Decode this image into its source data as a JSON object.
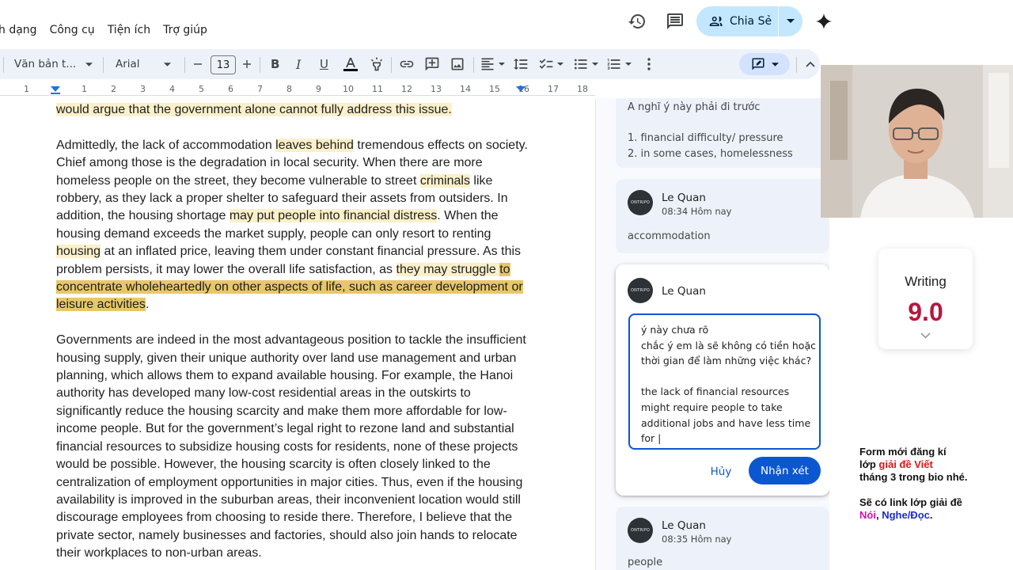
{
  "menu": [
    "h dạng",
    "Công cụ",
    "Tiện ích",
    "Trợ giúp"
  ],
  "header": {
    "share_label": "Chia Sẻ"
  },
  "toolbar": {
    "style_value": "Văn bản t...",
    "font_value": "Arial",
    "font_size": "13"
  },
  "ruler": {
    "numbers": [
      "1",
      "1",
      "2",
      "3",
      "4",
      "5",
      "6",
      "7",
      "8",
      "9",
      "10",
      "11",
      "12",
      "13",
      "14",
      "15",
      "16",
      "17",
      "18"
    ]
  },
  "document": {
    "p0_l1": "would argue that the government alone cannot fully address this issue.",
    "p1": {
      "a": "Admittedly, the lack of accommodation ",
      "b": "leaves behind",
      "c": " tremendous effects on society. Chief among those is the degradation in local security. When there are more homeless people on the street, they become vulnerable to street ",
      "d": "criminals",
      "e": " like robbery, as they lack a proper shelter to safeguard their assets from outsiders. In addition, the housing shortage ",
      "f": "may put people into financial distress",
      "g": ". When the housing demand exceeds the market supply, people can only resort to renting ",
      "h": "housing",
      "i": " at an inflated price, leaving them under constant financial pressure. As this problem persists, it may lower the overall life satisfaction, as ",
      "j": "they may struggle ",
      "k": "to concentrate wholeheartedly on other aspects of life, such as career development or leisure activities",
      "l": "."
    },
    "p2": "Governments are indeed in the most advantageous position to tackle the insufficient housing supply, given their unique authority over land use management and urban planning, which allows them to expand available housing. For example, the Hanoi authority has developed many low-cost residential areas in the outskirts to significantly reduce the housing scarcity and make them more affordable for low-income people. But for the government’s legal right to rezone land and substantial financial resources to subsidize housing costs for residents, none of these projects would be possible. However, the housing scarcity is often closely linked to the centralization of employment opportunities in major cities. Thus, even if the housing availability is improved in the suburban areas, their inconvenient location would still discourage employees from choosing to reside there. Therefore, I believe that the private sector, namely businesses and factories, should also join hands to relocate their workplaces to non-urban areas."
  },
  "comments": {
    "c0": {
      "line1": "A nghĩ ý này phải đi trước",
      "line2": "1. financial difficulty/ pressure",
      "line3": "2. in some cases, homelessness"
    },
    "c1": {
      "avatar": "ONTRIPO",
      "author": "Le Quan",
      "time": "08:34 Hôm nay",
      "text": "accommodation"
    },
    "c2": {
      "avatar": "ONTRIPO",
      "author": "Le Quan",
      "reply_text": "ý này chưa rõ\nchắc ý em là sẽ không có tiền hoặc thời gian để làm những việc khác?\n\nthe lack of financial resources might require people to take additional jobs and have less time for |",
      "cancel_label": "Hủy",
      "submit_label": "Nhận xét"
    },
    "c3": {
      "avatar": "ONTRIPO",
      "author": "Le Quan",
      "time": "08:35 Hôm nay",
      "text": "people"
    }
  },
  "overlay": {
    "score_label": "Writing",
    "score_value": "9.0",
    "promo": {
      "l1": "Form mới đăng kí",
      "l2a": "lớp ",
      "l2b": "giải đề Viết",
      "l3": "tháng 3 trong bio nhé.",
      "l4": "Sẽ có link lớp giải đề",
      "l5a": "Nói",
      "l5b": ", ",
      "l5c": "Nghe/Đọc",
      "l5d": "."
    }
  },
  "colors": {
    "accent": "#0b57d0",
    "share_bg": "#c2e7ff",
    "toolbar_bg": "#edf2fa",
    "highlight": "#fbf0c9",
    "highlight_selected": "#e7c76a",
    "score": "#b5183e"
  }
}
